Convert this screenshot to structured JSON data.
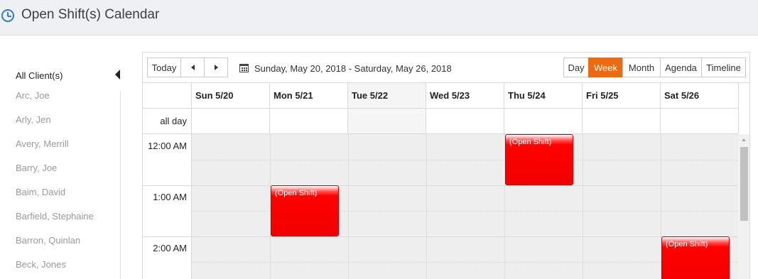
{
  "header": {
    "title": "Open Shift(s) Calendar",
    "icon": "clock-icon"
  },
  "sidebar": {
    "all_label": "All Client(s)",
    "clients": [
      "Arc, Joe",
      "Arly, Jen",
      "Avery, Merrill",
      "Barry, Joe",
      "Baim, David",
      "Barfield, Stephaine",
      "Barron, Quinlan",
      "Beck, Jones"
    ]
  },
  "toolbar": {
    "today": "Today",
    "range": "Sunday, May 20, 2018 - Saturday, May 26, 2018",
    "views": [
      "Day",
      "Week",
      "Month",
      "Agenda",
      "Timeline"
    ],
    "active_view": "Week"
  },
  "calendar": {
    "days": [
      "Sun 5/20",
      "Mon 5/21",
      "Tue 5/22",
      "Wed 5/23",
      "Thu 5/24",
      "Fri 5/25",
      "Sat 5/26"
    ],
    "today_index": 2,
    "all_day_label": "all day",
    "times": [
      "12:00 AM",
      "1:00 AM",
      "2:00 AM"
    ],
    "events": [
      {
        "title": "(Open Shift)",
        "day": "Thu 5/24",
        "start": "12:00 AM",
        "end": "1:00 AM"
      },
      {
        "title": "(Open Shift)",
        "day": "Mon 5/21",
        "start": "1:00 AM",
        "end": "2:00 AM"
      },
      {
        "title": "(Open Shift)",
        "day": "Sat 5/26",
        "start": "2:00 AM",
        "end": "3:00 AM"
      }
    ]
  },
  "colors": {
    "accent": "#ee6a10",
    "event": "#ff0000",
    "icon": "#2d7bd1"
  }
}
